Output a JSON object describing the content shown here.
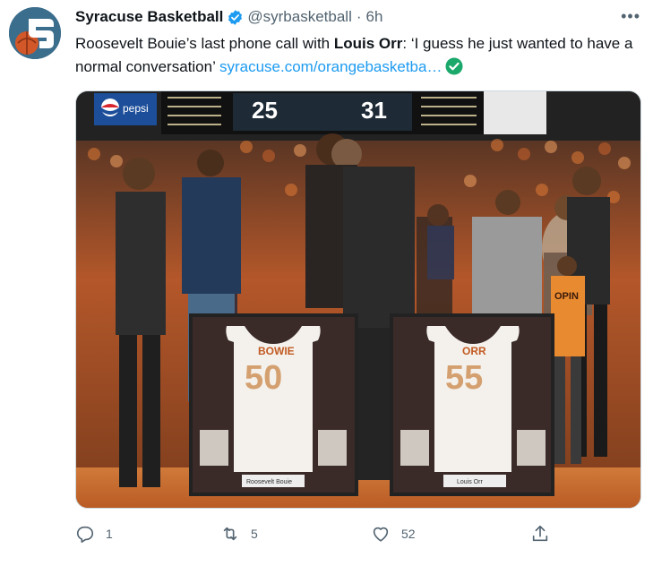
{
  "tweet": {
    "author_name": "Syracuse Basketball",
    "handle": "@syrbasketball",
    "separator": "·",
    "time": "6h",
    "more_label": "•••",
    "text_part1": "Roosevelt Bouie’s last phone call with ",
    "text_bold": "Louis Orr",
    "text_part2": ": ‘I guess he just wanted to have a normal conversation’ ",
    "link_text": "syracuse.com/orangebasketba…"
  },
  "media": {
    "scoreboard_brand": "pepsi",
    "score_left": "25",
    "score_right": "31",
    "jersey_left_name": "BOWIE",
    "jersey_left_number": "50",
    "jersey_right_name": "ORR",
    "jersey_right_number": "55",
    "plaque_left": "Roosevelt Bouie",
    "plaque_right": "Louis Orr",
    "kid_shirt": "OPIN"
  },
  "actions": {
    "reply_count": "1",
    "retweet_count": "5",
    "like_count": "52",
    "share_icon": "share-icon"
  },
  "colors": {
    "accent": "#1d9bf0",
    "verified": "#1d9bf0",
    "secondary_text": "#536471",
    "court": "#c56a2b",
    "crowd_orange": "#d9712f"
  }
}
